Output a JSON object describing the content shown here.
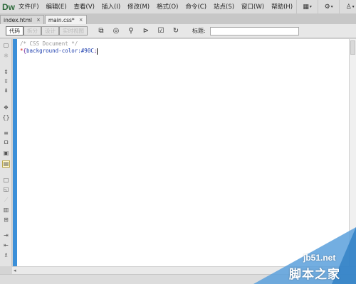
{
  "app": {
    "logo": "Dw",
    "menu": [
      "文件(F)",
      "编辑(E)",
      "查看(V)",
      "插入(I)",
      "修改(M)",
      "格式(O)",
      "命令(C)",
      "站点(S)",
      "窗口(W)",
      "帮助(H)"
    ]
  },
  "tabs": [
    {
      "label": "index.html",
      "close": "×",
      "active": false
    },
    {
      "label": "main.css*",
      "close": "×",
      "active": true
    }
  ],
  "toolbar": {
    "view_buttons": [
      "代码",
      "拆分",
      "设计",
      "实时视图"
    ],
    "title_label": "标题:",
    "title_value": ""
  },
  "editor": {
    "line1": "/* CSS Document */",
    "line2_selector": "*",
    "line2_open": "{",
    "line2_body": "background-color:#90C",
    "line2_close": ";"
  },
  "watermark": {
    "url": "jb51.net",
    "brand": "脚本之家"
  },
  "colors": {
    "accent_stripe": "#3b8fd8",
    "comment": "#9a9a9a",
    "selector": "#d02020",
    "property": "#1e3fae"
  }
}
